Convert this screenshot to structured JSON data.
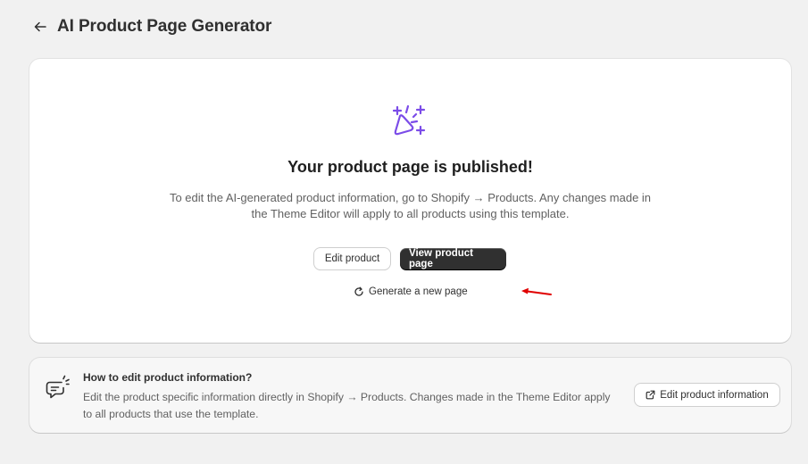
{
  "header": {
    "title": "AI Product Page Generator",
    "back_icon": "arrow-left-icon"
  },
  "published_card": {
    "icon": "magic-sparkle-icon",
    "heading": "Your product page is published!",
    "description": "To edit the AI-generated product information, go to Shopify → Products. Any changes made in the Theme Editor will apply to all products using this template.",
    "edit_product_label": "Edit product",
    "view_page_label": "View product page",
    "regenerate_label": "Generate a new page",
    "regenerate_icon": "refresh-icon"
  },
  "info_card": {
    "icon": "chat-bubble-icon",
    "title": "How to edit product information?",
    "description": "Edit the product specific information directly in Shopify → Products. Changes made in the Theme Editor apply to all products that use the template.",
    "button_label": "Edit product information",
    "button_icon": "external-link-icon"
  },
  "colors": {
    "accent_purple": "#7b4ce8",
    "annotation_red": "#e00000",
    "primary_button": "#303030"
  }
}
